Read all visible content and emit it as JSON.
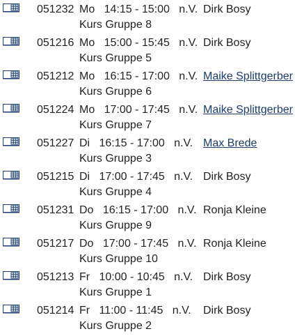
{
  "courses": [
    {
      "number": "051232",
      "day": "Mo",
      "time": "14:15 - 15:00",
      "note": "n.V.",
      "instructor": "Dirk Bosy",
      "instructor_link": false,
      "group": "Kurs Gruppe 8"
    },
    {
      "number": "051216",
      "day": "Mo",
      "time": "15:00 - 15:45",
      "note": "n.V.",
      "instructor": "Dirk Bosy",
      "instructor_link": false,
      "group": "Kurs Gruppe 5"
    },
    {
      "number": "051212",
      "day": "Mo",
      "time": "16:15 - 17:00",
      "note": "n.V.",
      "instructor": "Maike Splittgerber",
      "instructor_link": true,
      "group": "Kurs Gruppe 6"
    },
    {
      "number": "051224",
      "day": "Mo",
      "time": "17:00 - 17:45",
      "note": "n.V.",
      "instructor": "Maike Splittgerber",
      "instructor_link": true,
      "group": "Kurs Gruppe 7"
    },
    {
      "number": "051227",
      "day": "Di",
      "time": "16:15 - 17:00",
      "note": "n.V.",
      "instructor": "Max Brede",
      "instructor_link": true,
      "group": "Kurs Gruppe 3"
    },
    {
      "number": "051215",
      "day": "Di",
      "time": "17:00 - 17:45",
      "note": "n.V.",
      "instructor": "Dirk Bosy",
      "instructor_link": false,
      "group": "Kurs Gruppe 4"
    },
    {
      "number": "051231",
      "day": "Do",
      "time": "16:15 - 17:00",
      "note": "n.V.",
      "instructor": "Ronja Kleine",
      "instructor_link": false,
      "group": "Kurs Gruppe 9"
    },
    {
      "number": "051217",
      "day": "Do",
      "time": "17:00 - 17:45",
      "note": "n.V.",
      "instructor": "Ronja Kleine",
      "instructor_link": false,
      "group": "Kurs Gruppe 10"
    },
    {
      "number": "051213",
      "day": "Fr",
      "time": "10:00 - 10:45",
      "note": "n.V.",
      "instructor": "Dirk Bosy",
      "instructor_link": false,
      "group": "Kurs Gruppe 1"
    },
    {
      "number": "051214",
      "day": "Fr",
      "time": "11:00 - 11:45",
      "note": "n.V.",
      "instructor": "Dirk Bosy",
      "instructor_link": false,
      "group": "Kurs Gruppe 2"
    }
  ],
  "icons": {
    "add_to_schedule": "add-to-schedule-icon"
  },
  "colors": {
    "text": "#222222",
    "link": "#1a3d6b",
    "icon_stroke": "#1a3d6b"
  }
}
